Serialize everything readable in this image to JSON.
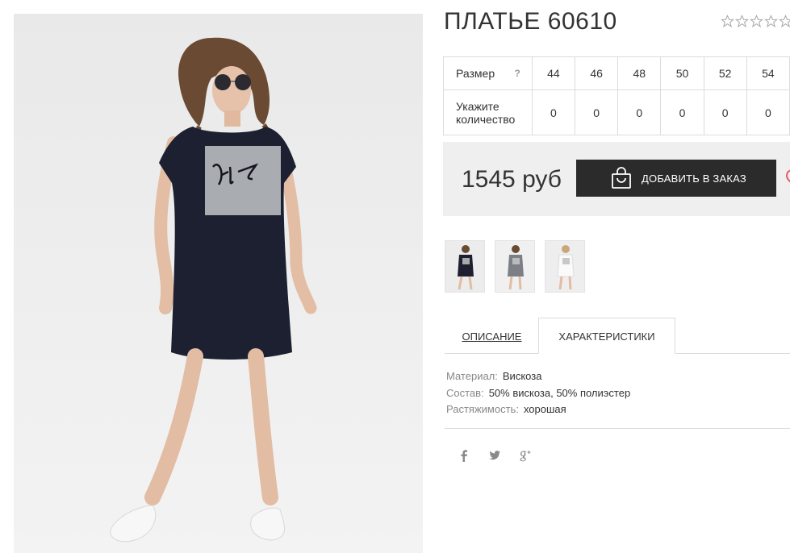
{
  "product": {
    "title": "ПЛАТЬЕ 60610",
    "rating": {
      "stars_total": 5,
      "stars_filled": 0
    }
  },
  "sizes": {
    "size_label": "Размер",
    "help_icon": "?",
    "qty_label_line1": "Укажите",
    "qty_label_line2": "количество",
    "values": [
      "44",
      "46",
      "48",
      "50",
      "52",
      "54"
    ],
    "quantities": [
      "0",
      "0",
      "0",
      "0",
      "0",
      "0"
    ]
  },
  "purchase": {
    "price": "1545 руб",
    "add_button": "ДОБАВИТЬ В ЗАКАЗ",
    "icons": [
      "shopping-bag-icon",
      "heart-icon"
    ]
  },
  "gallery": {
    "thumbnails": [
      "thumb-black-dress",
      "thumb-grey-dress",
      "thumb-white-dress"
    ]
  },
  "tabs": {
    "description": "ОПИСАНИЕ",
    "characteristics": "ХАРАКТЕРИСТИКИ",
    "active": "characteristics"
  },
  "characteristics": [
    {
      "key": "Материал:",
      "value": "Вискоза"
    },
    {
      "key": "Состав:",
      "value": "50% вискоза, 50% полиэстер"
    },
    {
      "key": "Растяжимость:",
      "value": "хорошая"
    }
  ],
  "social": [
    "facebook-icon",
    "twitter-icon",
    "google-plus-icon"
  ],
  "colors": {
    "button_bg": "#2b2b2b",
    "price_box_bg": "#efefef",
    "heart": "#e05a6e",
    "border": "#dcdcdc"
  }
}
